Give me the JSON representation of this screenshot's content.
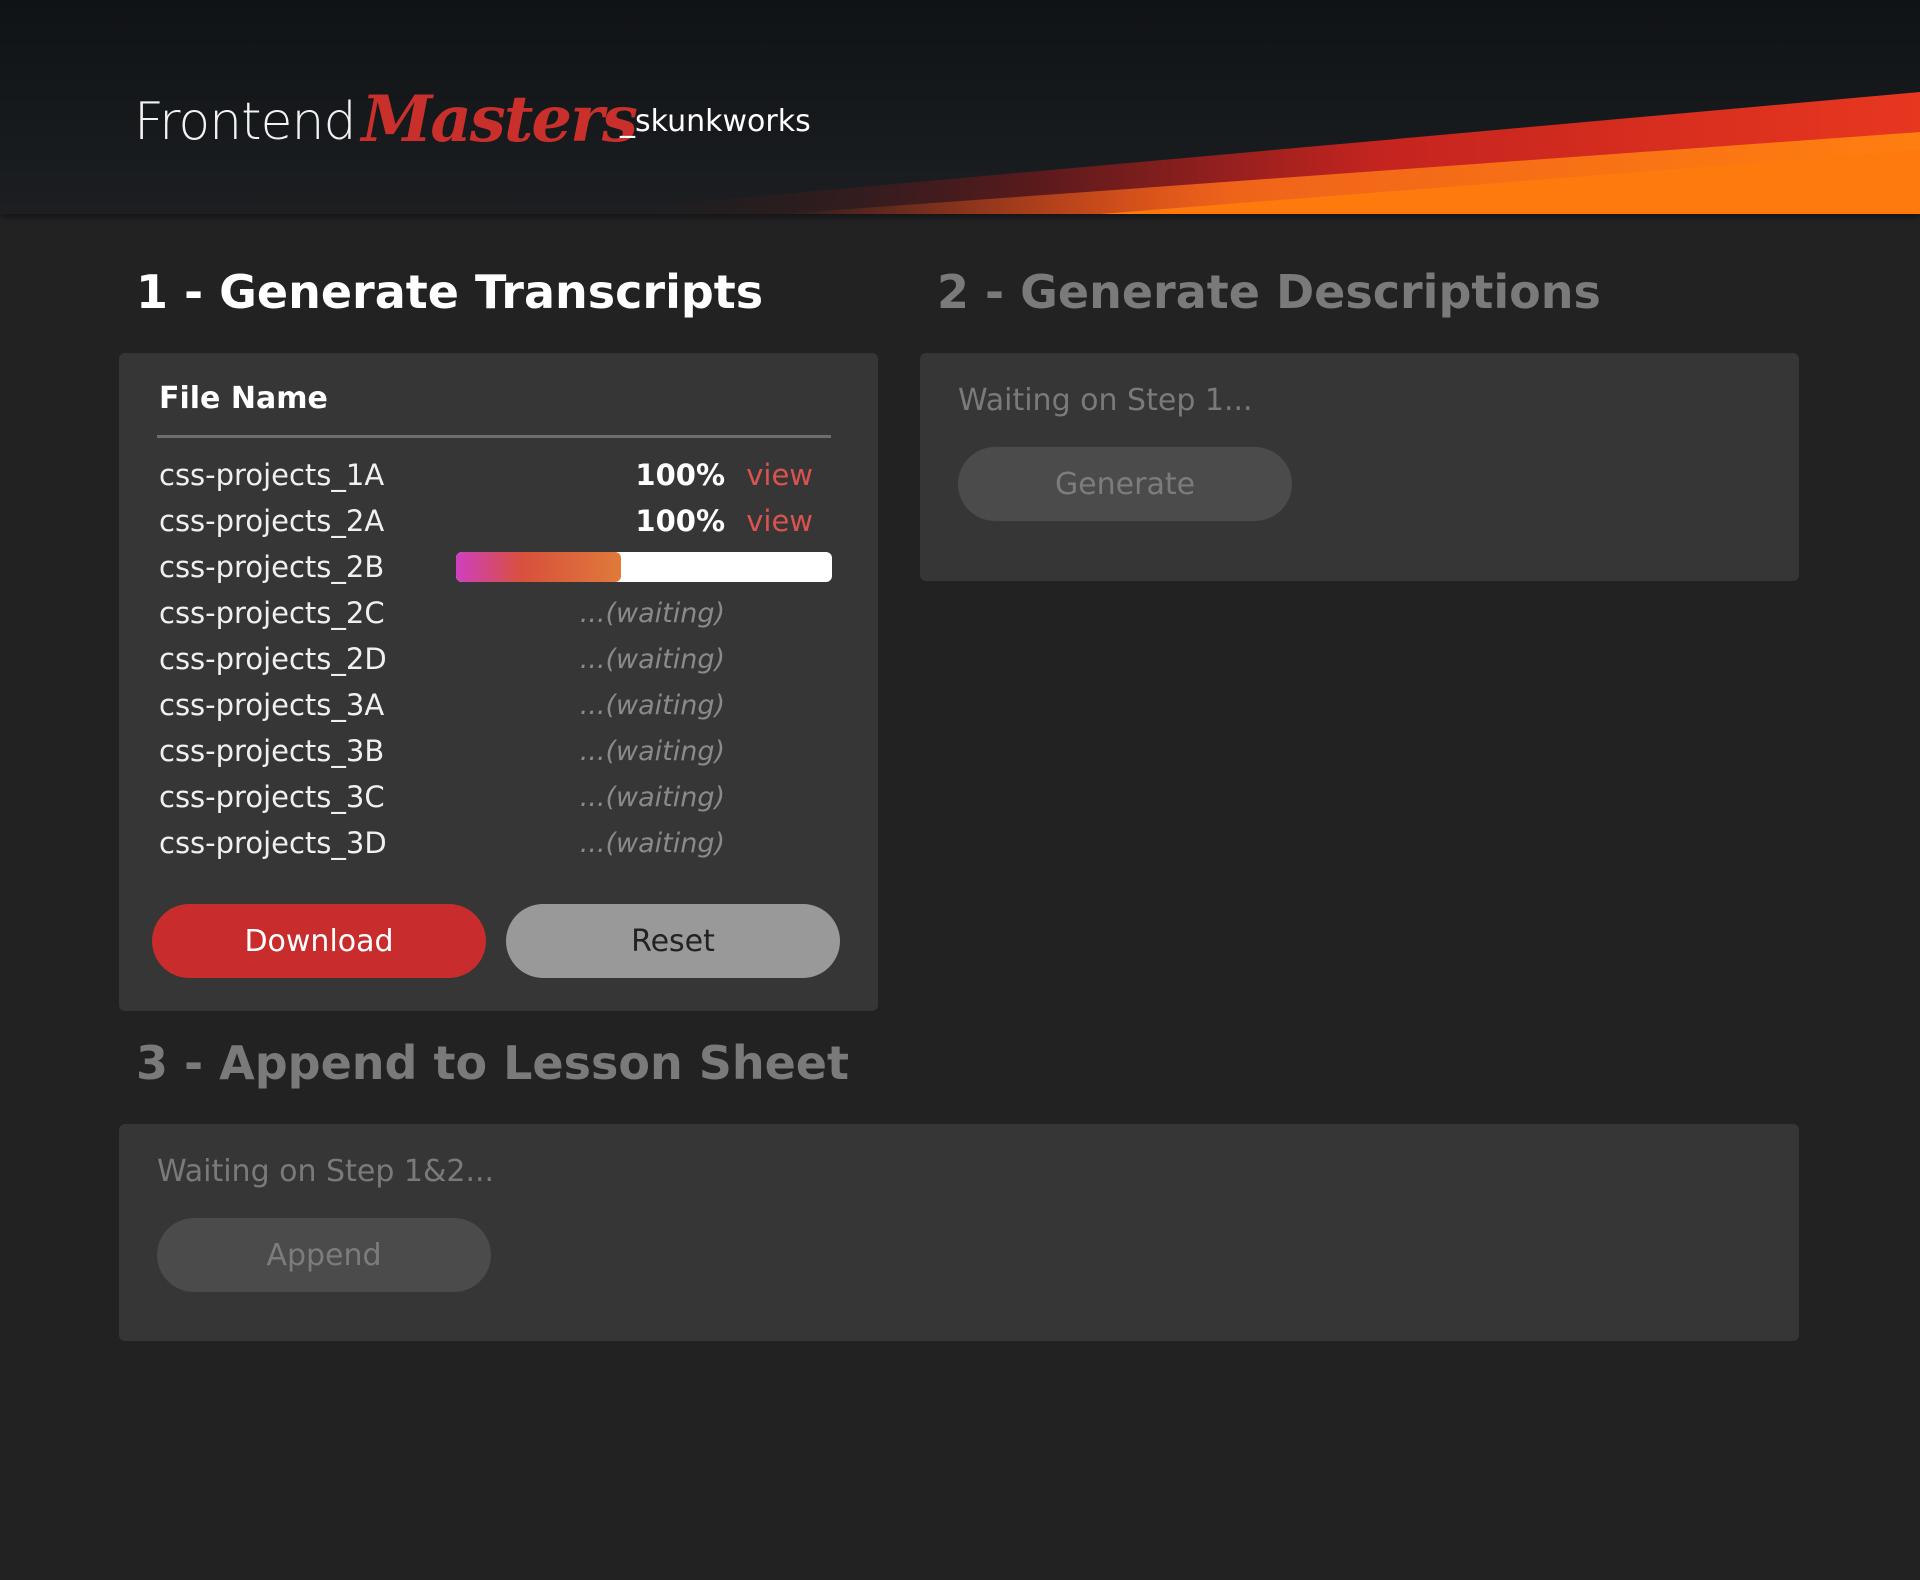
{
  "header": {
    "brand_part1": "Frontend",
    "brand_part2": "Masters",
    "subtitle": "_skunkworks",
    "colors": {
      "masters": "#c9302c",
      "flare_orange": "#ff7a12",
      "flare_red": "#c01f26"
    }
  },
  "step1": {
    "title": "1 - Generate Transcripts",
    "column_header": "File Name",
    "files": [
      {
        "name": "css-projects_1A",
        "status": "done",
        "percent": "100%",
        "action": "view"
      },
      {
        "name": "css-projects_2A",
        "status": "done",
        "percent": "100%",
        "action": "view"
      },
      {
        "name": "css-projects_2B",
        "status": "in-progress",
        "progress": 0.44
      },
      {
        "name": "css-projects_2C",
        "status": "waiting",
        "label": "...(waiting)"
      },
      {
        "name": "css-projects_2D",
        "status": "waiting",
        "label": "...(waiting)"
      },
      {
        "name": "css-projects_3A",
        "status": "waiting",
        "label": "...(waiting)"
      },
      {
        "name": "css-projects_3B",
        "status": "waiting",
        "label": "...(waiting)"
      },
      {
        "name": "css-projects_3C",
        "status": "waiting",
        "label": "...(waiting)"
      },
      {
        "name": "css-projects_3D",
        "status": "waiting",
        "label": "...(waiting)"
      }
    ],
    "download_label": "Download",
    "reset_label": "Reset"
  },
  "step2": {
    "title": "2 - Generate Descriptions",
    "waiting_text": "Waiting on Step 1...",
    "generate_label": "Generate"
  },
  "step3": {
    "title": "3 - Append to Lesson Sheet",
    "waiting_text": "Waiting on Step 1&2...",
    "append_label": "Append"
  }
}
